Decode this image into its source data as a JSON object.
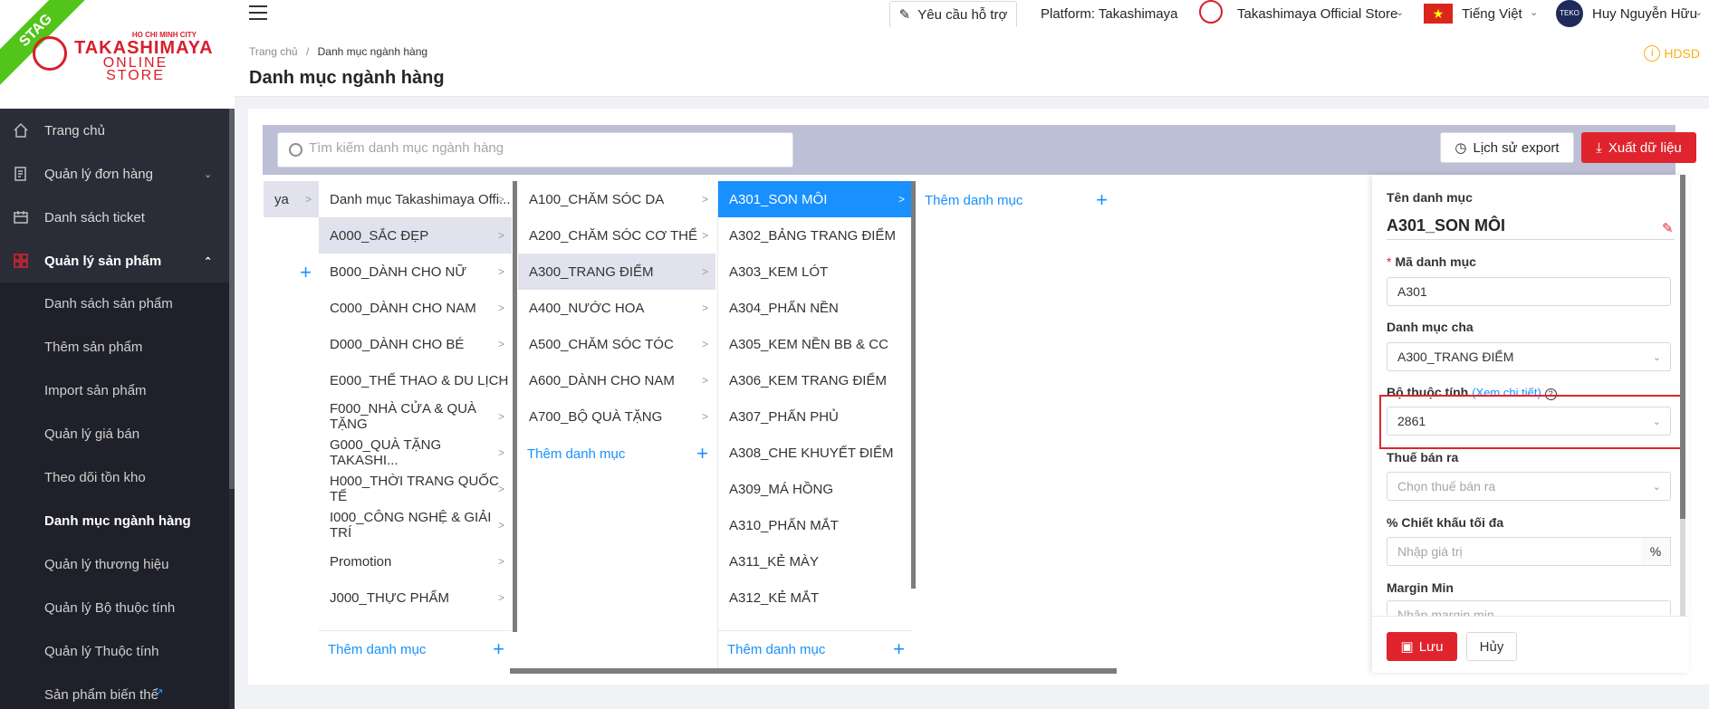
{
  "sidebar": {
    "env_badge": "STAG",
    "logo": {
      "city": "HO CHI MINH CITY",
      "brand": "TAKASHIMAYA",
      "sub": "ONLINE STORE"
    },
    "items": [
      {
        "label": "Trang chủ",
        "icon": "home-icon"
      },
      {
        "label": "Quản lý đơn hàng",
        "icon": "order-icon"
      },
      {
        "label": "Danh sách ticket",
        "icon": "ticket-icon"
      },
      {
        "label": "Quản lý sản phẩm",
        "icon": "grid-icon"
      }
    ],
    "sub_items": [
      "Danh sách sản phẩm",
      "Thêm sản phẩm",
      "Import sản phẩm",
      "Quản lý giá bán",
      "Theo dõi tồn kho",
      "Danh mục ngành hàng",
      "Quản lý thương hiệu",
      "Quản lý Bộ thuộc tính",
      "Quản lý Thuộc tính",
      "Sản phẩm biến thể"
    ]
  },
  "topbar": {
    "support": "Yêu cầu hỗ trợ",
    "platform": "Platform: Takashimaya",
    "store": "Takashimaya Official Store",
    "language": "Tiếng Việt",
    "flag_star": "★",
    "avatar_text": "TEKO",
    "user": "Huy Nguyễn Hữu"
  },
  "header": {
    "breadcrumb_home": "Trang chủ",
    "breadcrumb_sep": "/",
    "breadcrumb_current": "Danh mục ngành hàng",
    "title": "Danh mục ngành hàng",
    "help": "HDSD",
    "help_icon_text": "i"
  },
  "toolbar": {
    "search_placeholder": "Tìm kiếm danh mục ngành hàng",
    "export_history": "Lịch sử export",
    "export_data": "Xuất dữ liệu"
  },
  "columns": {
    "col0": {
      "partial_label": "ya"
    },
    "col1": {
      "items": [
        "Danh mục Takashimaya Offi...",
        "A000_SẮC ĐẸP",
        "B000_DÀNH CHO NỮ",
        "C000_DÀNH CHO NAM",
        "D000_DÀNH CHO BÉ",
        "E000_THỂ THAO & DU LỊCH",
        "F000_NHÀ CỬA & QUÀ TẶNG",
        "G000_QUÀ TẶNG TAKASHI...",
        "H000_THỜI TRANG QUỐC TẾ",
        "I000_CÔNG NGHỆ & GIẢI TRÍ",
        "Promotion",
        "J000_THỰC PHẨM"
      ],
      "add_label": "Thêm danh mục"
    },
    "col2": {
      "items": [
        "A100_CHĂM SÓC DA",
        "A200_CHĂM SÓC CƠ THỂ",
        "A300_TRANG ĐIỂM",
        "A400_NƯỚC HOA",
        "A500_CHĂM SÓC TÓC",
        "A600_DÀNH CHO NAM",
        "A700_BỘ QUÀ TẶNG"
      ],
      "add_label": "Thêm danh mục"
    },
    "col3": {
      "items": [
        "A301_SON MÔI",
        "A302_BẢNG TRANG ĐIỂM",
        "A303_KEM LÓT",
        "A304_PHẤN NỀN",
        "A305_KEM NỀN BB & CC",
        "A306_KEM TRANG ĐIỂM",
        "A307_PHẤN PHỦ",
        "A308_CHE KHUYẾT ĐIỂM",
        "A309_MÁ HỒNG",
        "A310_PHẤN MẮT",
        "A311_KẺ MÀY",
        "A312_KẺ MẮT"
      ],
      "add_label": "Thêm danh mục"
    },
    "col4": {
      "add_label": "Thêm danh mục"
    }
  },
  "form": {
    "name_label": "Tên danh mục",
    "name_value": "A301_SON MÔI",
    "code_label": "Mã danh mục",
    "code_required": "*",
    "code_value": "A301",
    "parent_label": "Danh mục cha",
    "parent_value": "A300_TRANG ĐIỂM",
    "attr_label": "Bộ thuộc tính",
    "attr_link": "(Xem chi tiết)",
    "attr_value": "2861",
    "tax_label": "Thuế bán ra",
    "tax_placeholder": "Chọn thuế bán ra",
    "discount_label": "% Chiết khấu tối đa",
    "discount_placeholder": "Nhập giá trị",
    "discount_suffix": "%",
    "margin_label": "Margin Min",
    "margin_placeholder": "Nhập margin min",
    "save": "Lưu",
    "cancel": "Hủy"
  },
  "colors": {
    "primary_red": "#e0242e",
    "link_blue": "#1890ff",
    "sidebar_bg": "#2a2c37",
    "toolbar_bg": "#bcbfd6"
  }
}
